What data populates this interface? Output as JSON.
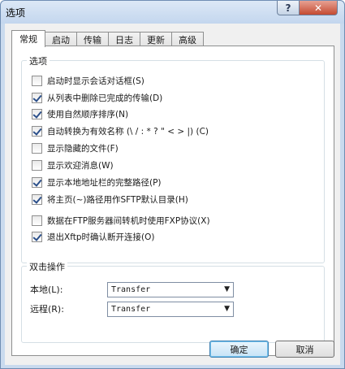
{
  "window": {
    "title": "选项",
    "help_glyph": "?",
    "close_glyph": "✕"
  },
  "tabs": [
    {
      "label": "常规",
      "active": true
    },
    {
      "label": "启动",
      "active": false
    },
    {
      "label": "传输",
      "active": false
    },
    {
      "label": "日志",
      "active": false
    },
    {
      "label": "更新",
      "active": false
    },
    {
      "label": "高级",
      "active": false
    }
  ],
  "options_group": {
    "legend": "选项",
    "items": [
      {
        "label": "启动时显示会话对话框(S)",
        "checked": false
      },
      {
        "label": "从列表中删除已完成的传输(D)",
        "checked": true
      },
      {
        "label": "使用自然顺序排序(N)",
        "checked": true
      },
      {
        "label": "自动转换为有效名称 (\\ / : * ? \" < > |) (C)",
        "checked": true
      },
      {
        "label": "显示隐藏的文件(F)",
        "checked": false
      },
      {
        "label": "显示欢迎消息(W)",
        "checked": false
      },
      {
        "label": "显示本地地址栏的完整路径(P)",
        "checked": true
      },
      {
        "label": "将主页(~)路径用作SFTP默认目录(H)",
        "checked": true
      },
      {
        "label": "数据在FTP服务器间转机时使用FXP协议(X)",
        "checked": false
      },
      {
        "label": "退出Xftp时确认断开连接(O)",
        "checked": true
      }
    ]
  },
  "double_click_group": {
    "legend": "双击操作",
    "local_label": "本地(L):",
    "local_value": "Transfer",
    "remote_label": "远程(R):",
    "remote_value": "Transfer"
  },
  "buttons": {
    "ok": "确定",
    "cancel": "取消"
  },
  "colors": {
    "accent": "#3c7fb1",
    "close_red": "#c44a31",
    "title_bg": "#c9daee"
  }
}
